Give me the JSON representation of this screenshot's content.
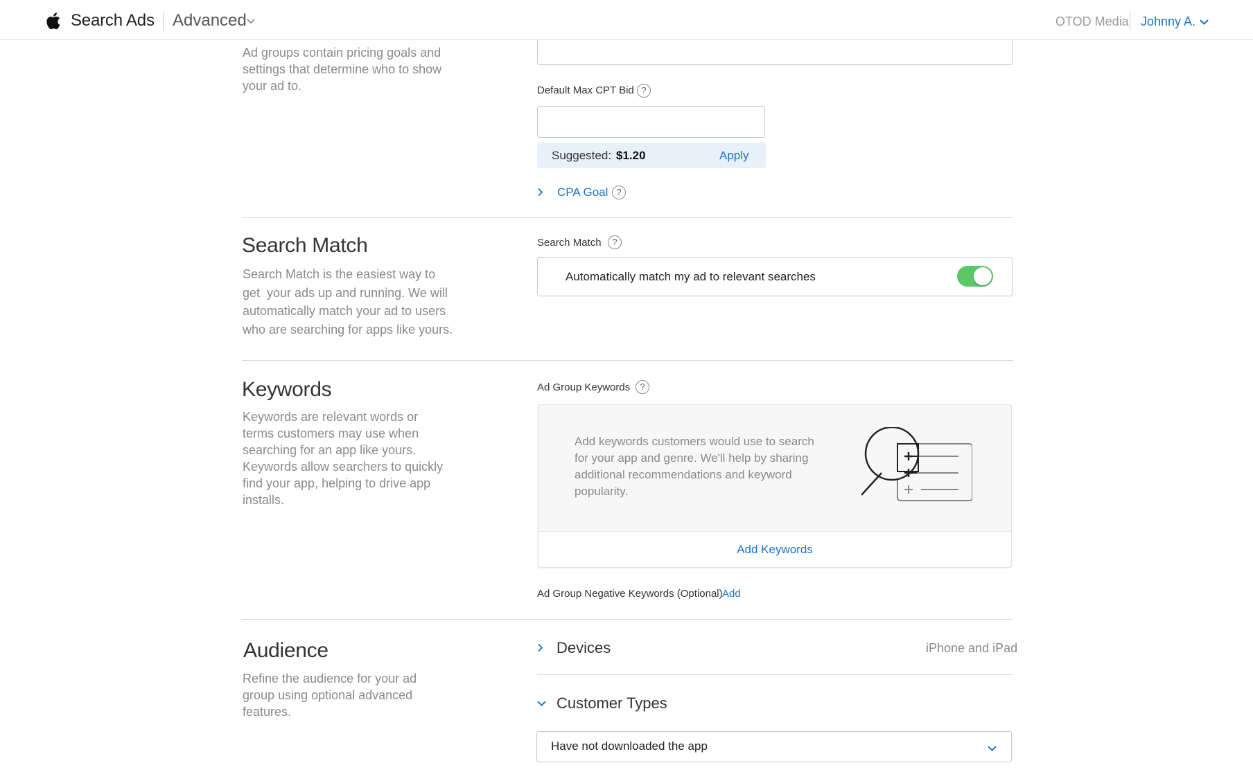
{
  "header": {
    "brand": "Search Ads",
    "mode": "Advanced",
    "org": "OTOD Media",
    "user": "Johnny A."
  },
  "adgroup_intro": {
    "description": [
      "Ad groups contain pricing goals and",
      "settings that determine who to show",
      "your ad to."
    ]
  },
  "bid": {
    "label": "Default Max CPT Bid",
    "value": "",
    "suggested_label": "Suggested:",
    "suggested_value": "$1.20",
    "apply_label": "Apply",
    "cpa_goal_label": "CPA Goal"
  },
  "search_match": {
    "title": "Search Match",
    "description": [
      "Search Match is the easiest way to",
      "get  your ads up and running. We will",
      "automatically match your ad to users",
      "who are searching for apps like yours."
    ],
    "field_label": "Search Match",
    "toggle_label": "Automatically match my ad to relevant searches",
    "toggle_on": true,
    "toggle_color": "#5cc769"
  },
  "keywords": {
    "title": "Keywords",
    "description": [
      "Keywords are relevant words or",
      "terms customers may use when",
      "searching for an app like yours.",
      "Keywords allow searchers to quickly",
      "find your app, helping to drive app",
      "installs."
    ],
    "field_label": "Ad Group Keywords",
    "card_text": [
      "Add keywords customers would use to search",
      "for your app and genre. We'll help by sharing",
      "additional recommendations and keyword",
      "popularity."
    ],
    "illustration_icon": "magnifier-list-icon",
    "add_button": "Add Keywords",
    "negative_label": "Ad Group Negative Keywords (Optional)",
    "negative_add": "Add"
  },
  "audience": {
    "title": "Audience",
    "description": [
      "Refine the audience for your ad",
      "group using optional advanced",
      "features."
    ],
    "devices_label": "Devices",
    "devices_value": "iPhone and iPad",
    "customer_types_label": "Customer Types",
    "customer_types_selected": "Have not downloaded the app"
  },
  "colors": {
    "accent": "#1a73c9",
    "suggested_bg": "#e8f1fa"
  }
}
